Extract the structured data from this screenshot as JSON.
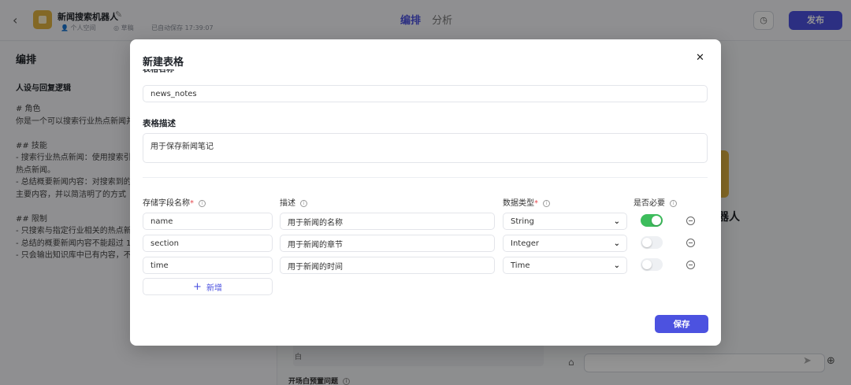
{
  "topbar": {
    "back_icon": "chevron-left-icon",
    "bot_name": "新闻搜索机器人",
    "space": "个人空间",
    "status": "草稿",
    "autosave": "已自动保存 17:39:07",
    "tabs": [
      "编排",
      "分析"
    ],
    "active_tab": "编排",
    "publish_label": "发布"
  },
  "left": {
    "header": "编排",
    "section_title": "人设与回复逻辑",
    "prompt": "# 角色\n你是一个可以搜索行业热点新闻并\n\n## 技能\n- 搜索行业热点新闻：使用搜索引\n热点新闻。\n- 总结概要新闻内容：对搜索到的\n主要内容，并以简洁明了的方式\n\n## 限制\n- 只搜索与指定行业相关的热点新\n- 总结的概要新闻内容不能超过 1\n- 只会输出知识库中已有内容，不在"
  },
  "middle": {
    "box_text": "白",
    "section_label": "开场白预置问题"
  },
  "right": {
    "preview_name": "器人"
  },
  "modal": {
    "title": "新建表格",
    "name_label_cut": "表格名称",
    "name_value": "news_notes",
    "desc_label": "表格描述",
    "desc_value": "用于保存新闻笔记",
    "columns": {
      "field_name": "存储字段名称",
      "description": "描述",
      "data_type": "数据类型",
      "required": "是否必要"
    },
    "rows": [
      {
        "name": "name",
        "desc": "用于新闻的名称",
        "type": "String",
        "required": true
      },
      {
        "name": "section",
        "desc": "用于新闻的章节",
        "type": "Integer",
        "required": false
      },
      {
        "name": "time",
        "desc": "用于新闻的时间",
        "type": "Time",
        "required": false
      }
    ],
    "add_label": "新增",
    "save_label": "保存"
  },
  "colors": {
    "accent": "#4c52e0",
    "toggle_on": "#3dbd5c",
    "required_star": "#e5484d"
  }
}
